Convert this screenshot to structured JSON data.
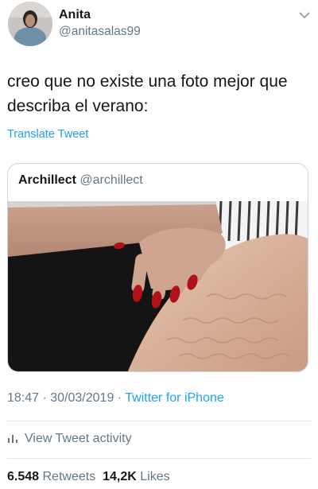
{
  "tweet": {
    "author_name": "Anita",
    "author_handle": "@anitasalas99",
    "text": "creo que no existe una foto mejor que\ndescriba el verano:",
    "translate_label": "Translate Tweet",
    "timestamp": "18:47 · 30/03/2019 · ",
    "source": "Twitter for iPhone",
    "activity_label": "View Tweet activity",
    "retweets_count": "6.548",
    "retweets_label": "Retweets",
    "likes_count": "14,2K",
    "likes_label": "Likes"
  },
  "quoted_tweet": {
    "author_name": "Archillect",
    "author_handle": "@archillect",
    "media": "photo"
  },
  "icons": {
    "caret": "chevron-down-icon",
    "activity": "bar-chart-icon"
  },
  "colors": {
    "link_blue": "#1da1f2",
    "secondary_gray": "#657786",
    "border": "#ccd6dd"
  }
}
